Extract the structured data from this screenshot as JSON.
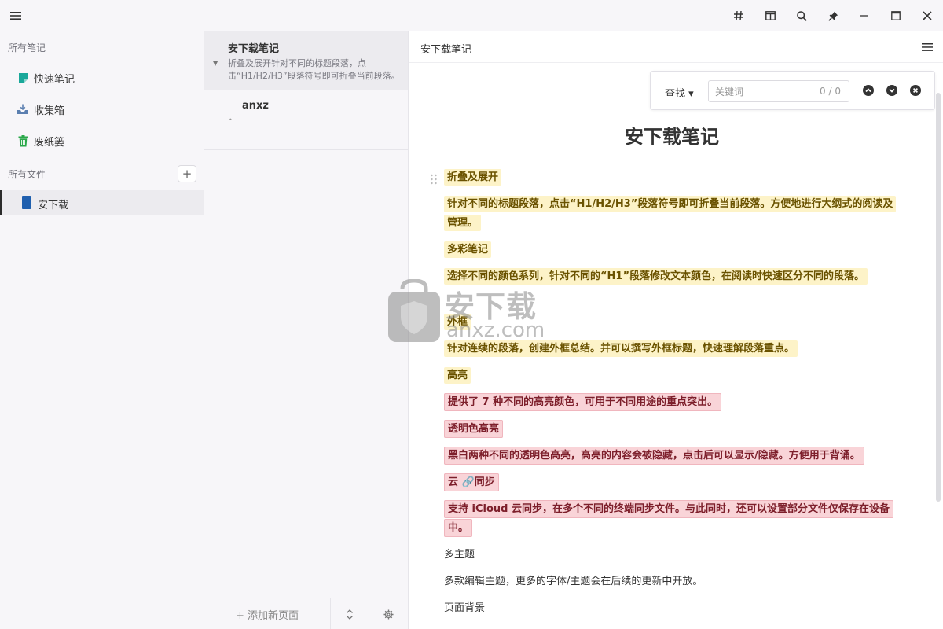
{
  "topbar": {
    "menu_icon": "hamburger-icon",
    "icons": [
      "hash-icon",
      "split-view-icon",
      "search-icon",
      "pin-icon",
      "minimize-icon",
      "maximize-icon",
      "close-icon"
    ]
  },
  "sidebar": {
    "all_notes_label": "所有笔记",
    "items": [
      {
        "label": "快速笔记",
        "icon": "quick-note-icon",
        "color": "#1aa89a"
      },
      {
        "label": "收集箱",
        "icon": "inbox-icon",
        "color": "#5b7fb0"
      },
      {
        "label": "废纸篓",
        "icon": "trash-icon",
        "color": "#2aa84a"
      }
    ],
    "all_files_label": "所有文件",
    "add_folder_label": "+",
    "folder": {
      "label": "安下载",
      "color": "#1f5fae"
    }
  },
  "notelist": {
    "notes": [
      {
        "title": "安下载笔记",
        "preview": "折叠及展开针对不同的标题段落，点击“H1/H2/H3”段落符号即可折叠当前段落。方便..."
      },
      {
        "title": "anxz",
        "preview": "•"
      }
    ],
    "add_page_label": "+ 添加新页面"
  },
  "editor": {
    "header_title": "安下载笔记",
    "find": {
      "mode_label": "查找 ▾",
      "placeholder": "关键词",
      "count": "0 / 0"
    },
    "doc_title": "安下载笔记",
    "paragraphs": [
      {
        "text": "折叠及展开",
        "style": "yellow"
      },
      {
        "text": "针对不同的标题段落，点击“H1/H2/H3”段落符号即可折叠当前段落。方便地进行大纲式的阅读及管理。",
        "style": "yellow"
      },
      {
        "text": "多彩笔记",
        "style": "yellow"
      },
      {
        "text": "选择不同的颜色系列，针对不同的“H1”段落修改文本颜色，在阅读时快速区分不同的段落。",
        "style": "yellow"
      },
      {
        "text": "外框",
        "style": "yellow"
      },
      {
        "text": "针对连续的段落，创建外框总结。并可以撰写外框标题，快速理解段落重点。",
        "style": "yellow"
      },
      {
        "text": "高亮",
        "style": "yellow"
      },
      {
        "text": "提供了 7 种不同的高亮颜色，可用于不同用途的重点突出。",
        "style": "pink"
      },
      {
        "text": "透明色高亮",
        "style": "pink"
      },
      {
        "text": "黑白两种不同的透明色高亮，高亮的内容会被隐藏，点击后可以显示/隐藏。方便用于背诵。",
        "style": "pink"
      },
      {
        "text": "云 🔗同步",
        "style": "pink"
      },
      {
        "text": "支持 iCloud 云同步，在多个不同的终端同步文件。与此同时，还可以设置部分文件仅保存在设备中。",
        "style": "pink"
      },
      {
        "text": "多主题",
        "style": "plain"
      },
      {
        "text": "多款编辑主题，更多的字体/主题会在后续的更新中开放。",
        "style": "plain"
      },
      {
        "text": "页面背景",
        "style": "plain"
      }
    ]
  },
  "watermark": {
    "title": "安下载",
    "subtitle": "anxz.com"
  }
}
